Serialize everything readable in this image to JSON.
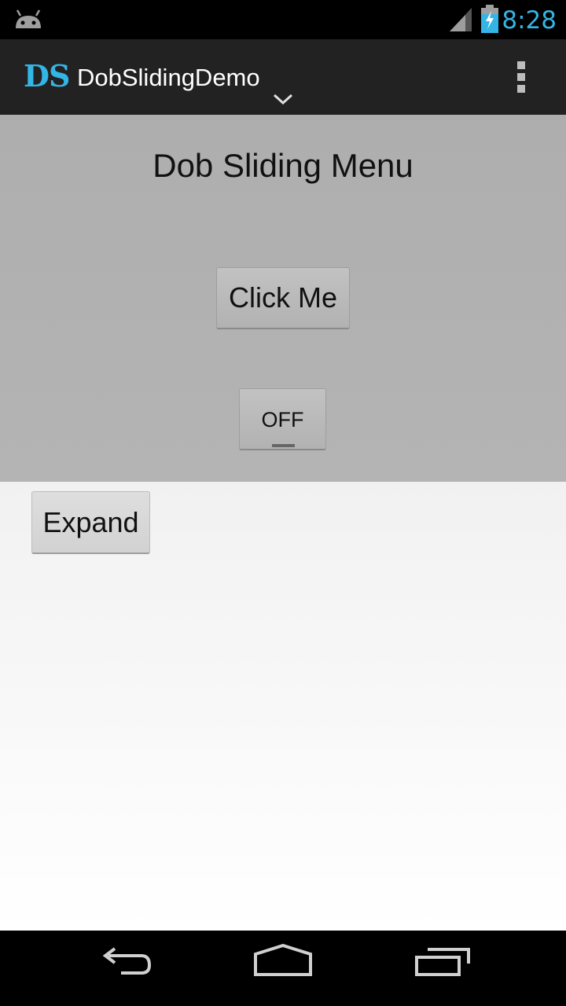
{
  "status_bar": {
    "time": "8:28",
    "icons": [
      "android-icon",
      "signal-icon",
      "battery-charging-icon"
    ]
  },
  "action_bar": {
    "logo_text": "DS",
    "title": "DobSlidingDemo",
    "icons": [
      "chevron-down-icon",
      "overflow-menu-icon"
    ]
  },
  "menu_panel": {
    "title": "Dob Sliding Menu",
    "click_button_label": "Click Me",
    "toggle_label": "OFF"
  },
  "content": {
    "expand_button_label": "Expand"
  },
  "nav_bar": {
    "icons": [
      "back-icon",
      "home-icon",
      "recents-icon"
    ]
  },
  "colors": {
    "accent": "#33b5e5",
    "action_bar_bg": "#222222",
    "menu_panel_bg": "#b0b0b0"
  }
}
